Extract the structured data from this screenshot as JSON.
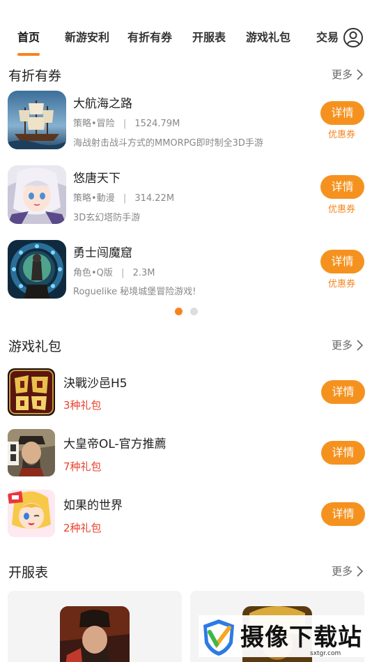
{
  "tabs": [
    {
      "label": "首页",
      "active": true
    },
    {
      "label": "新游安利"
    },
    {
      "label": "有折有券"
    },
    {
      "label": "开服表"
    },
    {
      "label": "游戏礼包"
    },
    {
      "label": "交易"
    }
  ],
  "coupon_section": {
    "title": "有折有券",
    "more": "更多",
    "games": [
      {
        "name": "大航海之路",
        "genre": "策略•冒险",
        "size": "1524.79M",
        "desc": "海战射击战斗方式的MMORPG即时制全3D手游",
        "detail": "详情",
        "tag": "优惠券"
      },
      {
        "name": "悠唐天下",
        "genre": "策略•動漫",
        "size": "314.22M",
        "desc": "3D玄幻塔防手游",
        "detail": "详情",
        "tag": "优惠券"
      },
      {
        "name": "勇士闯魔窟",
        "genre": "角色•Q版",
        "size": "2.3M",
        "desc": "Roguelike 秘境城堡冒险游戏!",
        "detail": "详情",
        "tag": "优惠券"
      }
    ],
    "separator": "|",
    "pager": {
      "pages": 2,
      "current": 1
    }
  },
  "gift_section": {
    "title": "游戏礼包",
    "more": "更多",
    "games": [
      {
        "name": "決戰沙邑H5",
        "gifts": "3种礼包",
        "detail": "详情"
      },
      {
        "name": "大皇帝OL-官方推薦",
        "gifts": "7种礼包",
        "detail": "详情"
      },
      {
        "name": "如果的世界",
        "gifts": "2种礼包",
        "detail": "详情"
      }
    ]
  },
  "server_section": {
    "title": "开服表",
    "more": "更多"
  },
  "watermark": {
    "text": "摄像下载站",
    "url": "sxtgr.com"
  },
  "colors": {
    "accent": "#f5921f",
    "gift_red": "#e8412d"
  }
}
